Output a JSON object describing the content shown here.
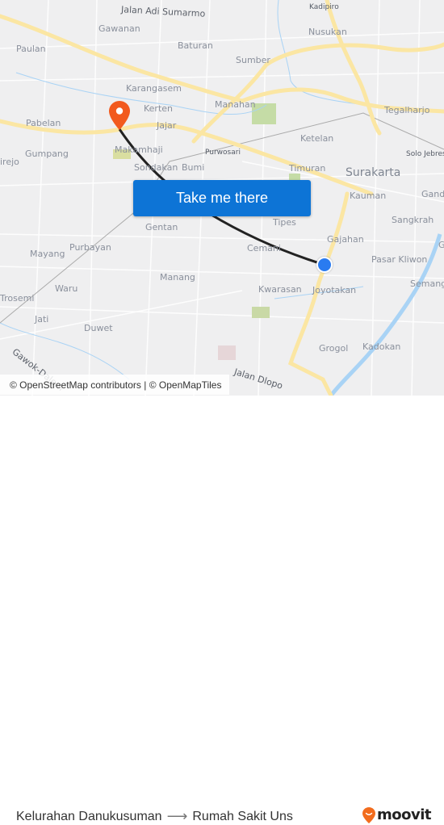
{
  "map": {
    "places": [
      {
        "label": "Jalan Adi Sumarmo",
        "type": "road"
      },
      {
        "label": "Kadipiro",
        "type": "small"
      },
      {
        "label": "Gawanan",
        "type": "place"
      },
      {
        "label": "Nusukan",
        "type": "place"
      },
      {
        "label": "Paulan",
        "type": "place"
      },
      {
        "label": "Baturan",
        "type": "place"
      },
      {
        "label": "Sumber",
        "type": "place"
      },
      {
        "label": "Karangasem",
        "type": "place"
      },
      {
        "label": "Manahan",
        "type": "place"
      },
      {
        "label": "Tegalharjo",
        "type": "place"
      },
      {
        "label": "Kerten",
        "type": "place"
      },
      {
        "label": "Pabelan",
        "type": "place"
      },
      {
        "label": "Jajar",
        "type": "place"
      },
      {
        "label": "Ketelan",
        "type": "place"
      },
      {
        "label": "Makamhaji",
        "type": "place"
      },
      {
        "label": "Purwosari",
        "type": "small"
      },
      {
        "label": "Gumpang",
        "type": "place"
      },
      {
        "label": "irejo",
        "type": "place"
      },
      {
        "label": "Solo Jebres",
        "type": "small"
      },
      {
        "label": "Sondakan",
        "type": "place"
      },
      {
        "label": "Bumi",
        "type": "place"
      },
      {
        "label": "Timuran",
        "type": "place"
      },
      {
        "label": "Surakarta",
        "type": "city"
      },
      {
        "label": "Kauman",
        "type": "place"
      },
      {
        "label": "Gand",
        "type": "place"
      },
      {
        "label": "Gentan",
        "type": "place"
      },
      {
        "label": "Tipes",
        "type": "place"
      },
      {
        "label": "Sangkrah",
        "type": "place"
      },
      {
        "label": "Purbayan",
        "type": "place"
      },
      {
        "label": "Mayang",
        "type": "place"
      },
      {
        "label": "Gajahan",
        "type": "place"
      },
      {
        "label": "Cemani",
        "type": "place"
      },
      {
        "label": "Pasar Kliwon",
        "type": "place"
      },
      {
        "label": "G",
        "type": "place"
      },
      {
        "label": "Semang",
        "type": "place"
      },
      {
        "label": "Waru",
        "type": "place"
      },
      {
        "label": "Manang",
        "type": "place"
      },
      {
        "label": "Kwarasan",
        "type": "place"
      },
      {
        "label": "Joyotakan",
        "type": "place"
      },
      {
        "label": "Trosemi",
        "type": "place"
      },
      {
        "label": "Jati",
        "type": "place"
      },
      {
        "label": "Duwet",
        "type": "place"
      },
      {
        "label": "Grogol",
        "type": "place"
      },
      {
        "label": "Kadokan",
        "type": "place"
      },
      {
        "label": "Gawok-Dalem",
        "type": "road"
      },
      {
        "label": "Jalan Dlopo",
        "type": "road"
      }
    ],
    "cta_label": "Take me there",
    "attribution": "© OpenStreetMap contributors | © OpenMapTiles",
    "colors": {
      "route": "#222222",
      "origin_pin": "#f25a1e",
      "destination_dot": "#2a7bf0",
      "cta": "#0d74d6",
      "major_road": "#fbe6a3",
      "water": "#a9d3f5",
      "park": "#c5dca6"
    }
  },
  "footer": {
    "origin": "Kelurahan Danukusuman",
    "arrow": "⟶",
    "destination": "Rumah Sakit Uns",
    "brand": "moovit",
    "brand_color": "#f26c1d"
  }
}
